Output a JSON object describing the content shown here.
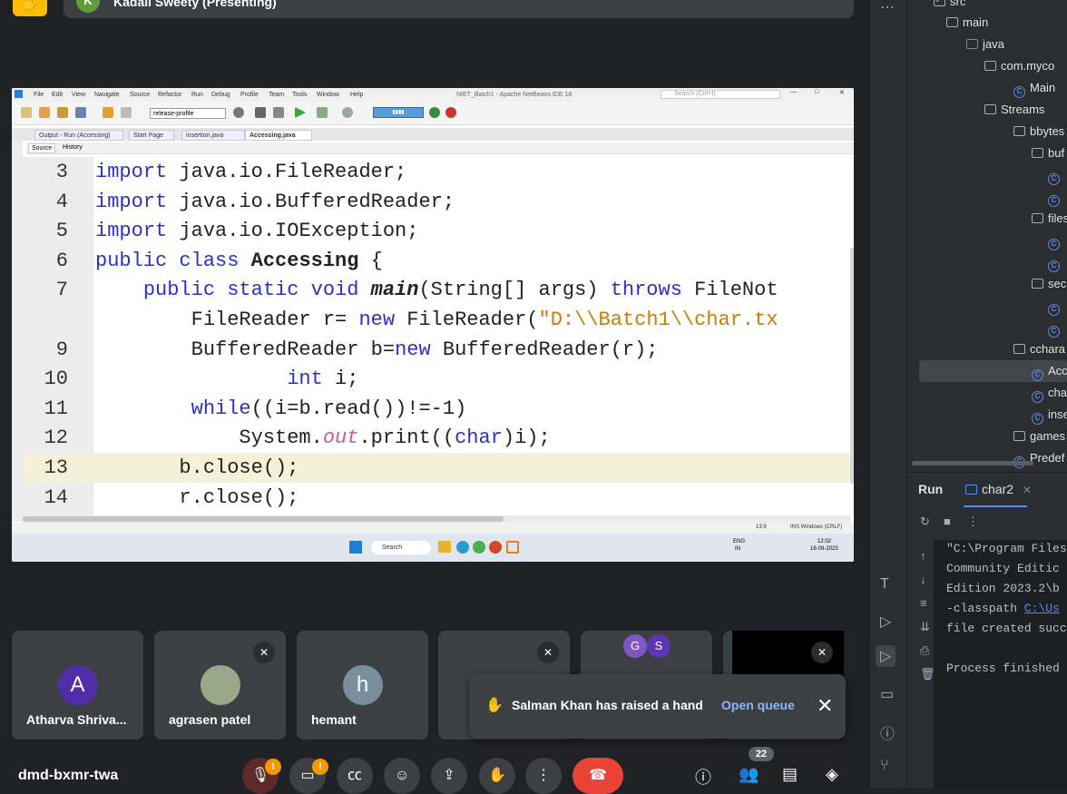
{
  "meet": {
    "presenter_initial": "K",
    "presenter_label": "Kadali Sweety (Presenting)",
    "meeting_code": "dmd-bxmr-twa",
    "participant_count": "22",
    "toast": {
      "message": "Salman Khan has raised a hand",
      "action": "Open queue"
    },
    "tiles": [
      {
        "initial": "A",
        "name": "Atharva Shriva...",
        "color": "#512da8"
      },
      {
        "initial": "",
        "name": "agrasen patel",
        "color": "#7a8a6a"
      },
      {
        "initial": "h",
        "name": "hemant",
        "color": "#78909c"
      }
    ],
    "tile_g_initials": [
      "G",
      "S"
    ]
  },
  "netbeans": {
    "title": "NIET_Batch1 - Apache NetBeans IDE 18",
    "search_placeholder": "Search (Ctrl+I)",
    "menu": [
      "File",
      "Edit",
      "View",
      "Navigate",
      "Source",
      "Refactor",
      "Run",
      "Debug",
      "Profile",
      "Team",
      "Tools",
      "Window",
      "Help"
    ],
    "config": "release-profile",
    "tabs": [
      "Output - Run (Accessing)",
      "Start Page",
      "insertion.java",
      "Accessing.java"
    ],
    "subtabs": [
      "Source",
      "History"
    ],
    "status_pos": "13:9",
    "status_mode": "INS Windows (CRLF)",
    "taskbar_search": "Search",
    "lang": "ENG",
    "lang2": "IN",
    "time": "12:02",
    "date": "18-09-2023"
  },
  "code": [
    {
      "n": "3",
      "t": "import java.io.FileReader;"
    },
    {
      "n": "4",
      "t": "import java.io.BufferedReader;"
    },
    {
      "n": "5",
      "t": "import java.io.IOException;"
    },
    {
      "n": "6",
      "t": "public class Accessing {"
    },
    {
      "n": "7",
      "t": "    public static void main(String[] args) throws FileNot"
    },
    {
      "n": "",
      "t": "        FileReader r= new FileReader(\"D:\\\\Batch1\\\\char.tx"
    },
    {
      "n": "9",
      "t": "        BufferedReader b=new BufferedReader(r);"
    },
    {
      "n": "10",
      "t": "                int i;"
    },
    {
      "n": "11",
      "t": "        while((i=b.read())!=-1)"
    },
    {
      "n": "12",
      "t": "            System.out.print((char)i);"
    },
    {
      "n": "13",
      "t": "       b.close();"
    },
    {
      "n": "14",
      "t": "       r.close();"
    }
  ],
  "ide": {
    "tree": [
      "src",
      "main",
      "java",
      "com.myco",
      "Main",
      "Streams",
      "bbytes",
      "buf",
      "files",
      "sec",
      "cchara",
      "Acc",
      "cha",
      "inse",
      "games",
      "Predef"
    ],
    "run_title": "Run",
    "run_tab": "char2",
    "console": [
      "\"C:\\Program Files",
      " Community Editic",
      " Edition 2023.2\\b",
      " -classpath ",
      "file created succ",
      "",
      "Process finished "
    ],
    "console_link": "C:\\Us"
  }
}
